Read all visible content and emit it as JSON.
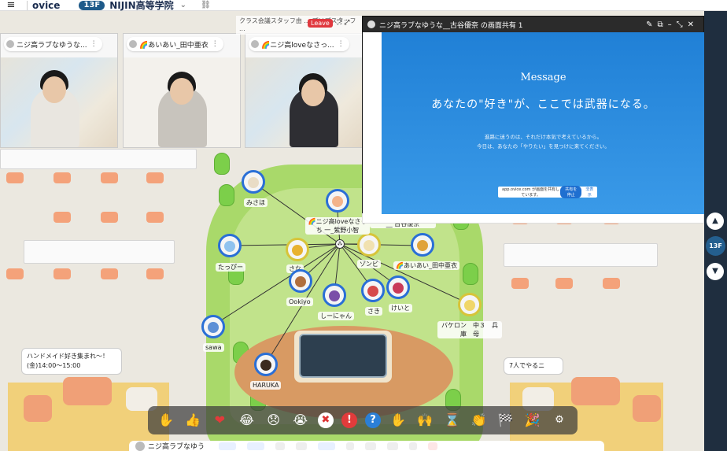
{
  "topbar": {
    "logo": "ovice",
    "floor": "13F",
    "space_name": "NIJIN高等学院",
    "chevron": "⌄",
    "link_icon": "link-icon"
  },
  "video_tiles": [
    {
      "label": "ニジ高ラブなゆうな..."
    },
    {
      "label": "🌈あいあい_田中亜衣"
    },
    {
      "label": "🌈ニジ高loveなさっ..."
    }
  ],
  "banner": {
    "text": "クラス会議スタッフ由 ...\nプリプスタッフ ...",
    "leave": "Leave"
  },
  "share": {
    "title": "ニジ高ラブなゆうな__古谷優奈 の画面共有 1",
    "heading": "Message",
    "main": "あなたの\"好き\"が、ここでは武器になる。",
    "sub1": "進路に迷うのは、それだけ本気で考えているから。",
    "sub2": "今日は、あなたの「やりたい」を見つけに来てください。",
    "toast_text": "app.ovice.com が画面を共有しています。",
    "toast_button": "共有を停止",
    "toast_hide": "非表示"
  },
  "avatars": [
    {
      "name": "みさほ"
    },
    {
      "name": "たっぴー"
    },
    {
      "name": "さな"
    },
    {
      "name": "Ookiyo"
    },
    {
      "name": "しーにゃん"
    },
    {
      "name": "さき"
    },
    {
      "name": "けいと"
    },
    {
      "name": "sawa"
    },
    {
      "name": "HARUKA"
    },
    {
      "name": "ゾンビ"
    },
    {
      "name": "🌈ニジ高loveなさっち\n一_紫野小智"
    },
    {
      "name": "ニジ高ラブなゆうな__\n古谷優奈"
    },
    {
      "name": "🌈あいあい_田中亜衣"
    },
    {
      "name": "バケロン　中３　兵\n庫　母"
    }
  ],
  "notes": {
    "handmade": "ハンドメイド好き集まれ〜！\n(金)14:00〜15:00",
    "seven": "7人でやるニ"
  },
  "rightbar": {
    "floor": "13F",
    "up": "▲",
    "down": "▼"
  },
  "reactions": [
    "✋",
    "👍",
    "❤",
    "😂",
    "😞",
    "😭",
    "✖",
    "!",
    "?",
    "✋",
    "🙌",
    "⌛",
    "👏",
    "🏁",
    "🎉",
    "⚙"
  ],
  "bottombar": {
    "me": "ニジ高ラブなゆう"
  },
  "colors": {
    "accent": "#1e5a8a",
    "leave": "#e0383e",
    "share_bg": "#2080d6",
    "avatar_ring": "#2a6fd6"
  }
}
